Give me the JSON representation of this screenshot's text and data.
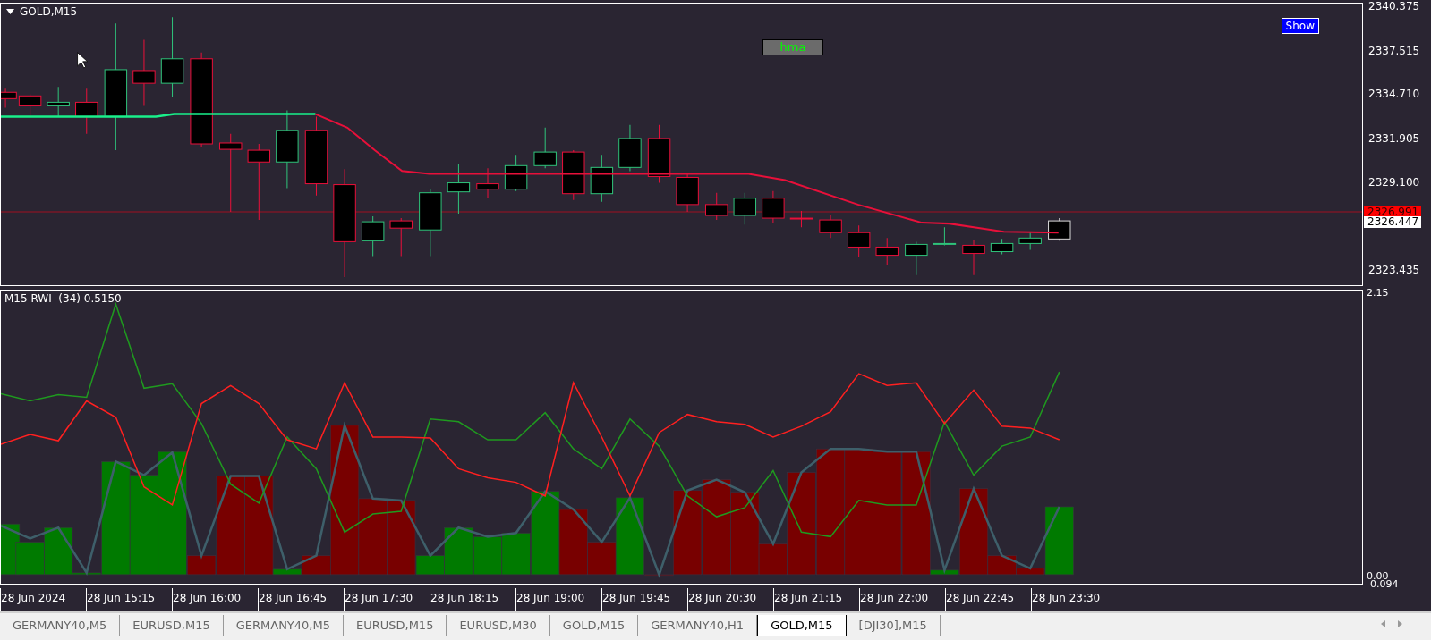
{
  "chart_window": {
    "title": "GOLD,M15",
    "buttons": [
      {
        "label": "Show",
        "kind": "blue"
      },
      {
        "label": "hma",
        "kind": "gray"
      }
    ]
  },
  "price_axis": {
    "ticks": [
      "2340.375",
      "2337.515",
      "2334.710",
      "2331.905",
      "2329.100",
      "2323.435"
    ],
    "markers": [
      {
        "label": "2326.991",
        "kind": "bid"
      },
      {
        "label": "2326.447",
        "kind": "last"
      }
    ]
  },
  "indicator": {
    "label": "M15 RWI  (34) 0.5150",
    "ticks": [
      "2.15",
      "0.00",
      "-0.094"
    ]
  },
  "time_axis": [
    "28 Jun 2024",
    "28 Jun 15:15",
    "28 Jun 16:00",
    "28 Jun 16:45",
    "28 Jun 17:30",
    "28 Jun 18:15",
    "28 Jun 19:00",
    "28 Jun 19:45",
    "28 Jun 20:30",
    "28 Jun 21:15",
    "28 Jun 22:00",
    "28 Jun 22:45",
    "28 Jun 23:30"
  ],
  "tabs": [
    {
      "label": "GERMANY40,M5",
      "selected": false
    },
    {
      "label": "EURUSD,M15",
      "selected": false
    },
    {
      "label": "GERMANY40,M5",
      "selected": false
    },
    {
      "label": "EURUSD,M15",
      "selected": false
    },
    {
      "label": "EURUSD,M30",
      "selected": false
    },
    {
      "label": "GOLD,M15",
      "selected": false
    },
    {
      "label": "GERMANY40,H1",
      "selected": false
    },
    {
      "label": "GOLD,M15",
      "selected": true
    },
    {
      "label": "[DJI30],M15",
      "selected": false
    }
  ]
}
